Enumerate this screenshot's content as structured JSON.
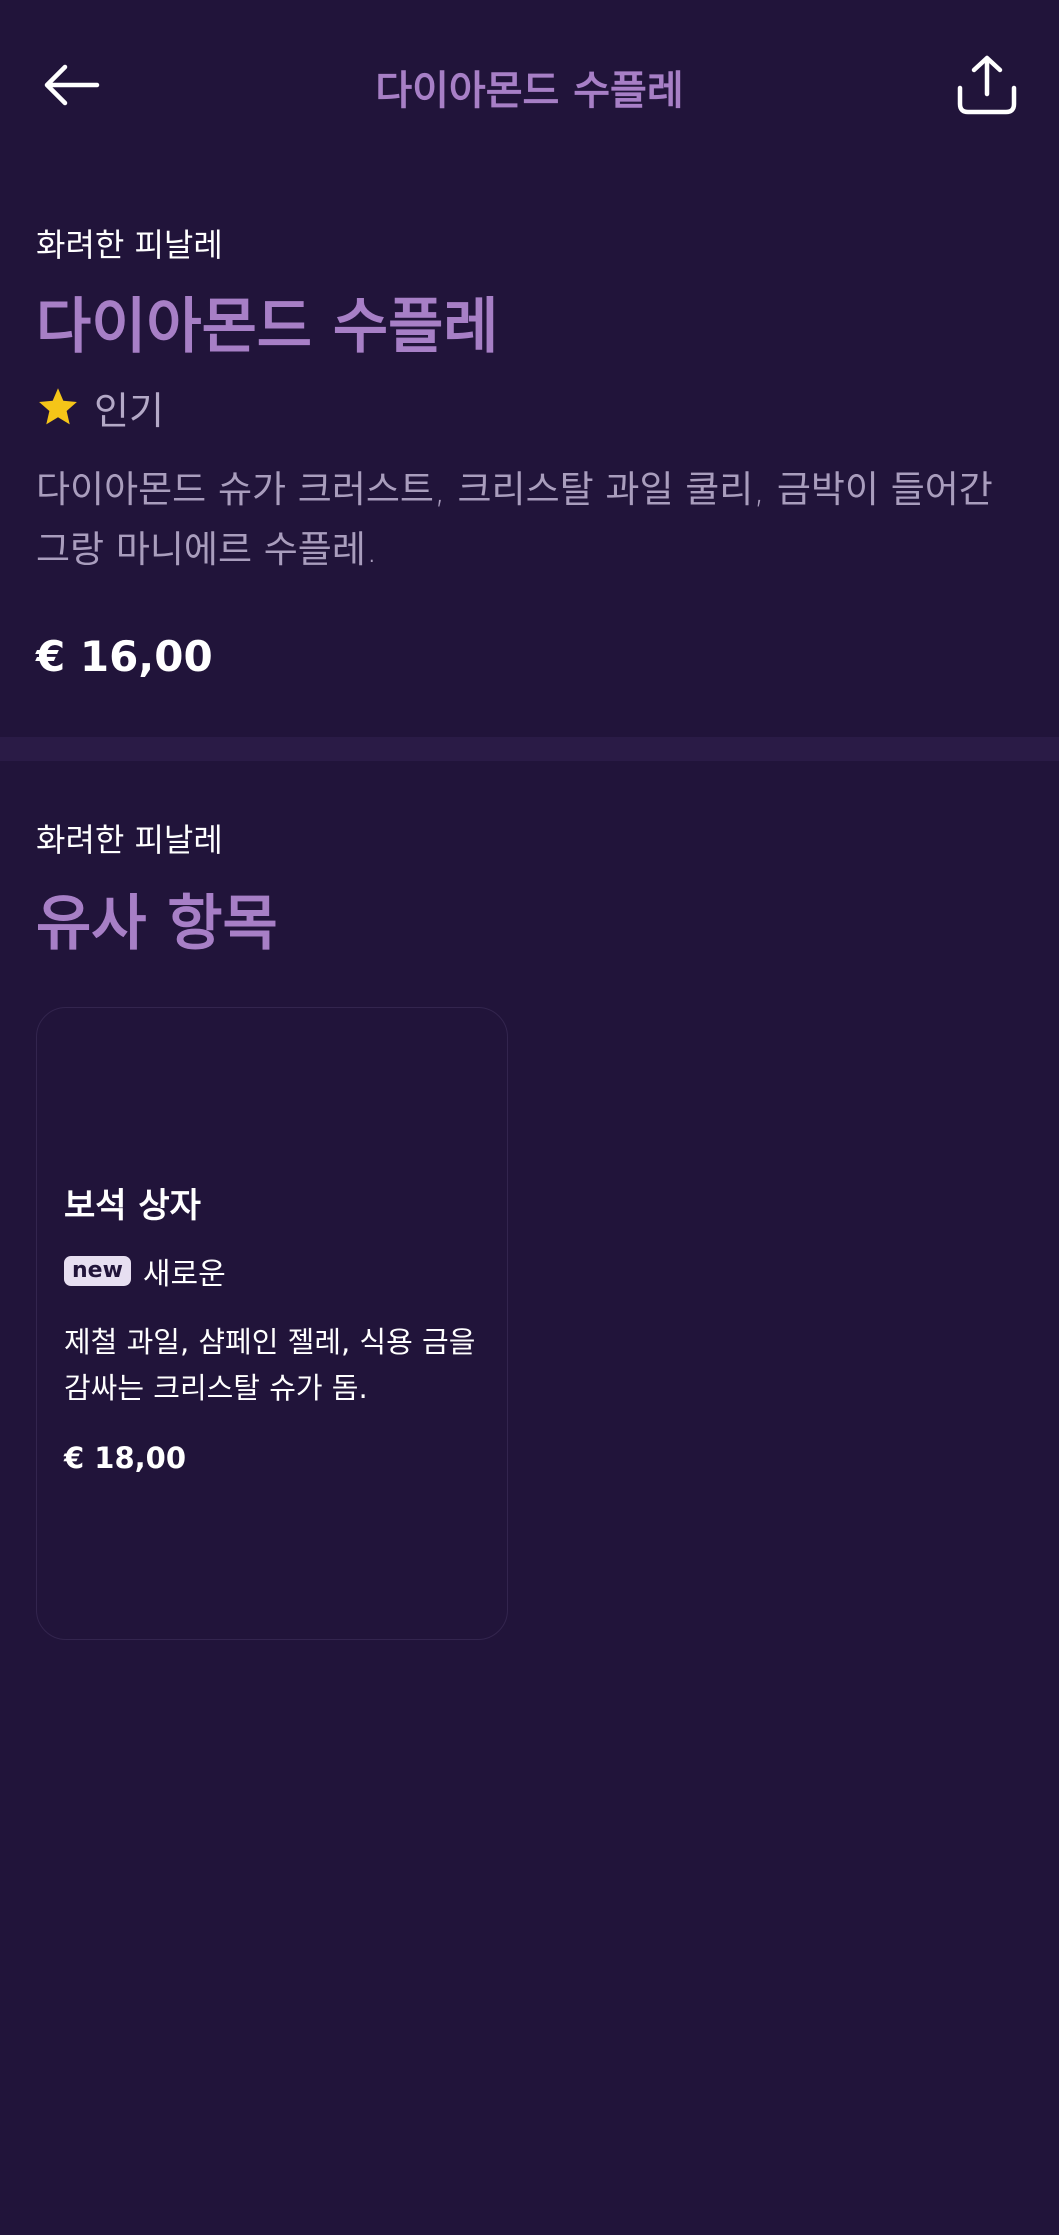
{
  "header": {
    "title": "다이아몬드 수플레",
    "back_icon": "arrow-left-icon",
    "share_icon": "share-icon"
  },
  "item": {
    "category": "화려한 피날레",
    "title": "다이아몬드 수플레",
    "tag_icon": "star-icon",
    "tag_label": "인기",
    "description": "다이아몬드 슈가 크러스트, 크리스탈 과일 쿨리, 금박이 들어간 그랑 마니에르 수플레.",
    "price": "€ 16,00"
  },
  "similar": {
    "category": "화려한 피날레",
    "title": "유사 항목",
    "cards": [
      {
        "title": "보석 상자",
        "badge": "new",
        "tag_label": "새로운",
        "description": "제철 과일, 샴페인 젤레, 식용 금을 감싸는 크리스탈 슈가 돔.",
        "price": "€ 18,00"
      }
    ]
  },
  "colors": {
    "background": "#21143a",
    "accent": "#a77fc6",
    "star": "#f5c518",
    "divider": "#2a1b46"
  }
}
